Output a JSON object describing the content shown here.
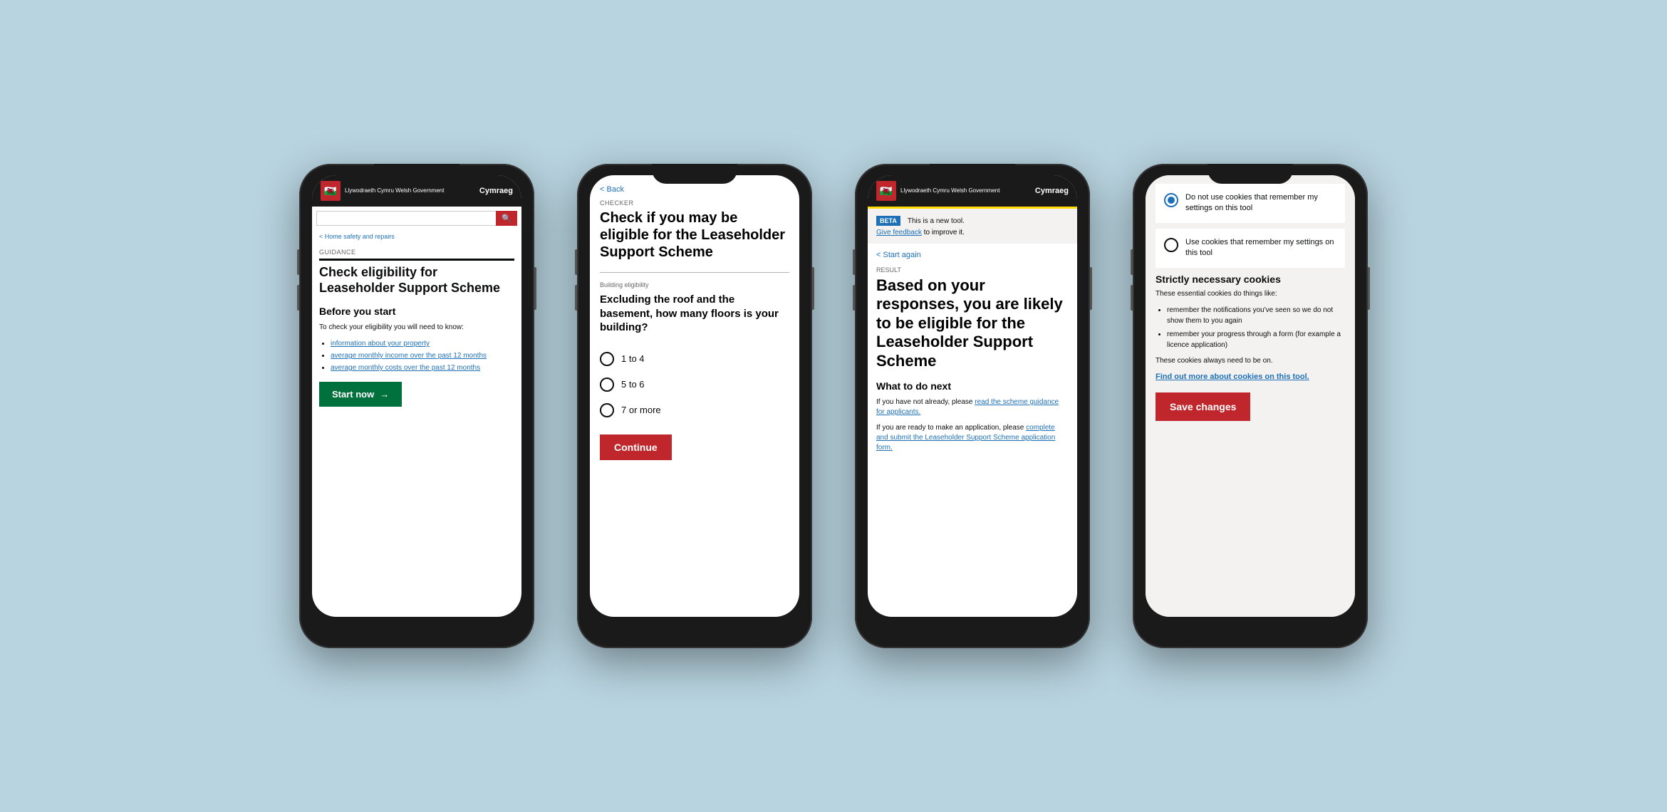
{
  "background_color": "#b8d4e0",
  "phone1": {
    "header": {
      "gov_name": "Llywodraeth Cymru\nWelsh Government",
      "cymraeg_label": "Cymraeg"
    },
    "search": {
      "placeholder": "",
      "btn_label": "🔍"
    },
    "breadcrumb": "Home safety and repairs",
    "guidance_label": "GUIDANCE",
    "title": "Check eligibility for Leaseholder Support Scheme",
    "before_start": "Before you start",
    "body": "To check your eligibility you will need to know:",
    "bullets": [
      "information about your property",
      "average monthly income over the past 12 months",
      "average monthly costs over the past 12 months"
    ],
    "start_btn": "Start now",
    "start_arrow": "→"
  },
  "phone2": {
    "back_label": "Back",
    "checker_label": "CHECKER",
    "title": "Check if you may be eligible for the Leaseholder Support Scheme",
    "section_label": "Building eligibility",
    "question": "Excluding the roof and the basement, how many floors is your building?",
    "options": [
      "1 to 4",
      "5 to 6",
      "7 or more"
    ],
    "continue_btn": "Continue"
  },
  "phone3": {
    "header": {
      "gov_name": "Llywodraeth Cymru\nWelsh Government",
      "cymraeg_label": "Cymraeg"
    },
    "beta_tag": "BETA",
    "beta_text": "This is a new tool.",
    "feedback_label": "Give feedback",
    "feedback_rest": "to improve it.",
    "start_again": "Start again",
    "result_label": "RESULT",
    "result_title": "Based on your responses, you are likely to be eligible for the Leaseholder Support Scheme",
    "what_next": "What to do next",
    "body1": "If you have not already, please",
    "link1": "read the scheme guidance for applicants.",
    "body2": "If you are ready to make an application, please",
    "link2": "complete and submit the Leaseholder Support Scheme application form."
  },
  "phone4": {
    "option1_label": "Do not use cookies that remember my settings on this tool",
    "option1_selected": true,
    "option2_label": "Use cookies that remember my settings on this tool",
    "option2_selected": false,
    "strictly_heading": "Strictly necessary cookies",
    "body_intro": "These essential cookies do things like:",
    "bullets": [
      "remember the notifications you've seen so we do not show them to you again",
      "remember your progress through a form (for example a licence application)"
    ],
    "always_text": "These cookies always need to be on.",
    "find_out_label": "Find out more about cookies on this tool.",
    "save_btn": "Save changes"
  }
}
